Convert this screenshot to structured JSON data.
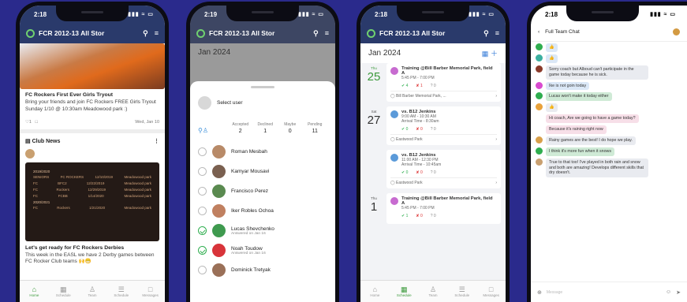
{
  "phone1": {
    "status_time": "2:18",
    "status_icons": "▮▮▮ ≈ ▭",
    "app_title": "FCR 2012-13 All Stor",
    "post": {
      "title": "FC Rockers First Ever Girls Tryout",
      "body": "Bring your friends and join FC Rockers FREE Girls Tryout Sunday 1/10 @ 10:30am Meadowood park :)",
      "date": "Wed, Jan 10"
    },
    "club_news_label": "Club News",
    "news_image": {
      "year1": "2019/2020",
      "year2": "2020/2021",
      "rows": [
        [
          "SENIORS",
          "FC ROCKERS",
          "12/10/2019",
          "Meadowood park"
        ],
        [
          "FC",
          "BFC2",
          "12/22/2019",
          "Meadowood park"
        ],
        [
          "FC",
          "Rockers",
          "12/29/2019",
          "Meadowood park"
        ],
        [
          "FC",
          "FCBB",
          "1/14/2020",
          "Meadowood park"
        ],
        [
          "FC",
          "Rockers",
          "1/21/2020",
          "Meadowood park"
        ]
      ]
    },
    "post2": {
      "title": "Let's get ready for FC Rockers Derbies",
      "body": "This week in the EASL we have 2 Derby games between FC Rocker Club teams 🙌😁"
    },
    "tabs": [
      "Home",
      "Schedule",
      "Team",
      "Schedule",
      "Messages"
    ]
  },
  "phone2": {
    "status_time": "2:19",
    "app_title": "FCR 2012-13 All Stor",
    "month": "Jan 2024",
    "select_user": "Select user",
    "counts": [
      {
        "label": "Accepted",
        "value": "2"
      },
      {
        "label": "Declined",
        "value": "1"
      },
      {
        "label": "Maybe",
        "value": "0"
      },
      {
        "label": "Pending",
        "value": "11"
      }
    ],
    "players": [
      {
        "name": "Roman Mesbah",
        "sub": "",
        "checked": false
      },
      {
        "name": "Kamyar Mousavi",
        "sub": "",
        "checked": false
      },
      {
        "name": "Francisco Perez",
        "sub": "",
        "checked": false
      },
      {
        "name": "Iker Robles Ochoa",
        "sub": "",
        "checked": false
      },
      {
        "name": "Lucas Shevchenko",
        "sub": "Answered on Jan 16",
        "checked": true
      },
      {
        "name": "Noah Toudow",
        "sub": "Answered on Jan 16",
        "checked": true
      },
      {
        "name": "Dominick Tretyak",
        "sub": "",
        "checked": false
      }
    ]
  },
  "phone3": {
    "status_time": "2:18",
    "app_title": "FCR 2012-13 All Stor",
    "month": "Jan 2024",
    "days": [
      {
        "dow": "Thu",
        "num": "25",
        "title": "Training @Bill Barber Memorial Park, field A",
        "time": "5:45 PM - 7:00 PM",
        "arrival": "",
        "stats": [
          "4",
          "1",
          "0"
        ],
        "loc": "Bill Barber Memorial Park, ...",
        "color": "purple"
      },
      {
        "dow": "Sat",
        "num": "27",
        "title": "vs. B12 Jenkins",
        "time": "9:00 AM - 10:30 AM",
        "arrival": "Arrival Time - 8:30am",
        "stats": [
          "0",
          "0",
          "0"
        ],
        "loc": "Eastwood Park",
        "color": "blue"
      },
      {
        "dow": "",
        "num": "",
        "title": "vs. B12 Jenkins",
        "time": "11:00 AM - 12:30 PM",
        "arrival": "Arrival Time - 10:45am",
        "stats": [
          "0",
          "0",
          "0"
        ],
        "loc": "Eastwood Park",
        "color": "blue"
      },
      {
        "dow": "Thu",
        "num": "1",
        "title": "Training @Bill Barber Memorial Park, field A",
        "time": "5:45 PM - 7:00 PM",
        "arrival": "",
        "stats": [
          "1",
          "0",
          "0"
        ],
        "loc": "",
        "color": "purple"
      }
    ]
  },
  "phone4": {
    "status_time": "2:18",
    "chat_title": "Full Team Chat",
    "messages": [
      {
        "text": "👍",
        "bubble": "blue",
        "av": "#2fae4f"
      },
      {
        "text": "👍",
        "bubble": "blue",
        "av": "#3bb0a0"
      },
      {
        "text": "Sorry coach but Alboud can't participate in the game today because he is sick.",
        "bubble": "grey",
        "av": "#8a3a2a"
      },
      {
        "text": "Ike is not goin today",
        "bubble": "blue",
        "av": "#d94bd0"
      },
      {
        "text": "Lucas won't make it today either",
        "bubble": "green",
        "av": "#2fae4f"
      },
      {
        "text": "👍",
        "bubble": "grey",
        "av": "#e9a23b"
      },
      {
        "text": "Hi coach, Are we going to have a game today?",
        "bubble": "pink",
        "av": "#e9a23b"
      },
      {
        "text": "Because it's raining right now",
        "bubble": "pink",
        "av": ""
      },
      {
        "text": "Rainy games are the best! I do hope we play.",
        "bubble": "grey",
        "av": "#d9a04a"
      },
      {
        "text": "I think it's more fun when it snows",
        "bubble": "green",
        "av": "#2fae4f"
      },
      {
        "text": "True to that too! I've played in both rain and snow and both are amazing! Develops different skills that dry doesn't.",
        "bubble": "grey",
        "av": "#c9a070"
      }
    ],
    "compose_placeholder": "Message"
  }
}
